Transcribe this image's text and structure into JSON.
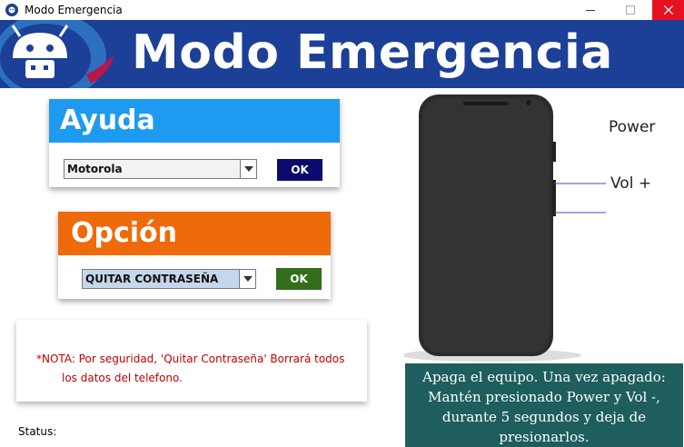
{
  "window": {
    "title": "Modo Emergencia"
  },
  "banner": {
    "title": "Modo Emergencia"
  },
  "ayuda": {
    "heading": "Ayuda",
    "selected": "Motorola",
    "ok_label": "OK",
    "color": "#1e9af0"
  },
  "opcion": {
    "heading": "Opción",
    "selected": "QUITAR CONTRASEÑA",
    "ok_label": "OK",
    "color": "#ef6a0a"
  },
  "nota": {
    "line1": "*NOTA: Por seguridad, 'Quitar Contraseña' Borrará todos",
    "line2": "los datos del telefono."
  },
  "status": {
    "label": "Status:"
  },
  "phone": {
    "power_label": "Power",
    "vol_label": "Vol +"
  },
  "instructions": {
    "line1": "Apaga el equipo. Una vez apagado:",
    "line2": "Mantén presionado Power y Vol -,",
    "line3": "durante 5 segundos y deja de",
    "line4": "presionarlos."
  },
  "icons": [
    "android-icon",
    "minimize-icon",
    "maximize-icon",
    "close-icon",
    "dropdown-arrow-icon"
  ]
}
